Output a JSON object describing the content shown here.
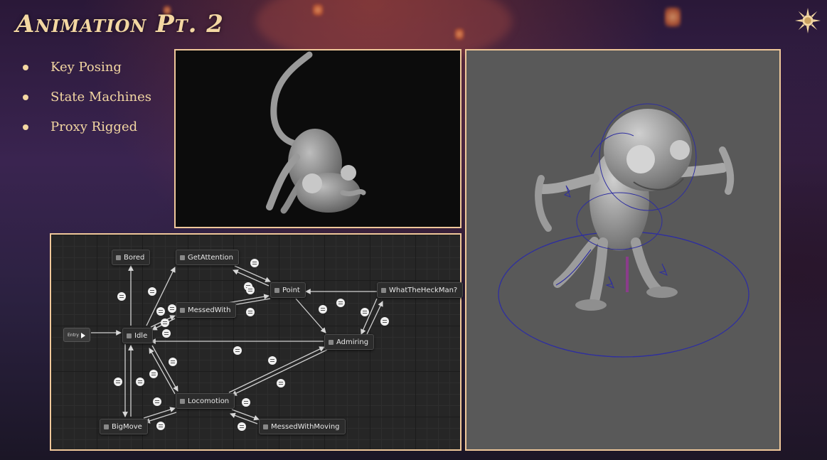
{
  "slide": {
    "title": "Animation Pt. 2",
    "bullets": [
      {
        "label": "Key Posing"
      },
      {
        "label": "State Machines"
      },
      {
        "label": "Proxy Rigged"
      }
    ]
  },
  "state_machine": {
    "entry_label": "Entry",
    "nodes": {
      "bored": "Bored",
      "get_attention": "GetAttention",
      "messed_with": "MessedWith",
      "idle": "Idle",
      "point": "Point",
      "what_the_heck_man": "WhatTheHeckMan?",
      "admiring": "Admiring",
      "locomotion": "Locomotion",
      "big_move": "BigMove",
      "messed_with_moving": "MessedWithMoving"
    }
  },
  "colors": {
    "accent": "#f3d7a2",
    "panel_border": "#f0c89a",
    "viewport_gray": "#595959",
    "graph_bg": "#262626",
    "rig_blue": "#3a3aa8"
  },
  "icons": {
    "logo": "sun-emblem-icon",
    "node": "state-node-icon",
    "transition": "transition-rule-icon"
  }
}
